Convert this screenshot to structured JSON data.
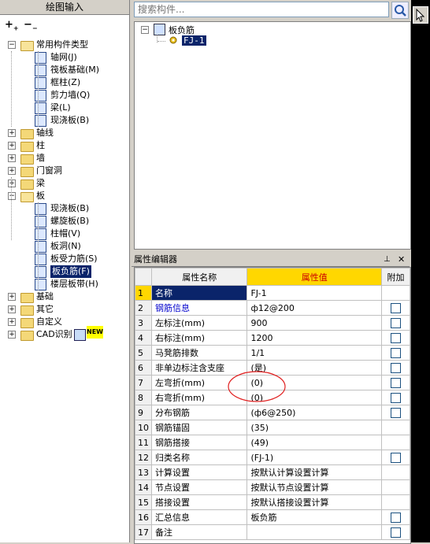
{
  "left_panel": {
    "title": "绘图输入",
    "tree": [
      {
        "label": "常用构件类型",
        "type": "folder",
        "level": 0,
        "expanded": true
      },
      {
        "label": "轴网(J)",
        "type": "item",
        "level": 1,
        "icon": "axis-grid-icon"
      },
      {
        "label": "筏板基础(M)",
        "type": "item",
        "level": 1,
        "icon": "raft-foundation-icon"
      },
      {
        "label": "框柱(Z)",
        "type": "item",
        "level": 1,
        "icon": "column-icon"
      },
      {
        "label": "剪力墙(Q)",
        "type": "item",
        "level": 1,
        "icon": "shear-wall-icon"
      },
      {
        "label": "梁(L)",
        "type": "item",
        "level": 1,
        "icon": "beam-icon"
      },
      {
        "label": "现浇板(B)",
        "type": "item",
        "level": 1,
        "icon": "slab-icon"
      },
      {
        "label": "轴线",
        "type": "folder",
        "level": 0,
        "expanded": false
      },
      {
        "label": "柱",
        "type": "folder",
        "level": 0,
        "expanded": false
      },
      {
        "label": "墙",
        "type": "folder",
        "level": 0,
        "expanded": false
      },
      {
        "label": "门窗洞",
        "type": "folder",
        "level": 0,
        "expanded": false
      },
      {
        "label": "梁",
        "type": "folder",
        "level": 0,
        "expanded": false
      },
      {
        "label": "板",
        "type": "folder",
        "level": 0,
        "expanded": true
      },
      {
        "label": "现浇板(B)",
        "type": "item",
        "level": 1,
        "icon": "slab-icon"
      },
      {
        "label": "螺旋板(B)",
        "type": "item",
        "level": 1,
        "icon": "spiral-slab-icon"
      },
      {
        "label": "柱帽(V)",
        "type": "item",
        "level": 1,
        "icon": "column-cap-icon"
      },
      {
        "label": "板洞(N)",
        "type": "item",
        "level": 1,
        "icon": "slab-hole-icon"
      },
      {
        "label": "板受力筋(S)",
        "type": "item",
        "level": 1,
        "icon": "slab-rebar-icon"
      },
      {
        "label": "板负筋(F)",
        "type": "item",
        "level": 1,
        "icon": "negative-rebar-icon",
        "selected": true
      },
      {
        "label": "楼层板带(H)",
        "type": "item",
        "level": 1,
        "icon": "floor-strip-icon"
      },
      {
        "label": "基础",
        "type": "folder",
        "level": 0,
        "expanded": false
      },
      {
        "label": "其它",
        "type": "folder",
        "level": 0,
        "expanded": false
      },
      {
        "label": "自定义",
        "type": "folder",
        "level": 0,
        "expanded": false
      },
      {
        "label": "CAD识别",
        "type": "folder",
        "level": 0,
        "expanded": false,
        "badge": "NEW"
      }
    ]
  },
  "search": {
    "placeholder": "搜索构件..."
  },
  "component_tree": {
    "root_label": "板负筋",
    "child_label": "FJ-1"
  },
  "property_editor": {
    "title": "属性编辑器",
    "headers": {
      "num": "",
      "name": "属性名称",
      "value": "属性值",
      "extra": "附加"
    },
    "rows": [
      {
        "num": "1",
        "name": "名称",
        "value": "FJ-1",
        "checkbox": false,
        "name_color": "#0000cc",
        "selected": true
      },
      {
        "num": "2",
        "name": "钢筋信息",
        "value": "ф12@200",
        "checkbox": true,
        "name_color": "#0000cc"
      },
      {
        "num": "3",
        "name": "左标注(mm)",
        "value": "900",
        "checkbox": true
      },
      {
        "num": "4",
        "name": "右标注(mm)",
        "value": "1200",
        "checkbox": true
      },
      {
        "num": "5",
        "name": "马凳筋排数",
        "value": "1/1",
        "checkbox": true
      },
      {
        "num": "6",
        "name": "非单边标注含支座",
        "value": "(是)",
        "checkbox": true
      },
      {
        "num": "7",
        "name": "左弯折(mm)",
        "value": "(0)",
        "checkbox": true
      },
      {
        "num": "8",
        "name": "右弯折(mm)",
        "value": "(0)",
        "checkbox": true
      },
      {
        "num": "9",
        "name": "分布钢筋",
        "value": "(ф6@250)",
        "checkbox": true
      },
      {
        "num": "10",
        "name": "钢筋锚固",
        "value": "(35)",
        "checkbox": false
      },
      {
        "num": "11",
        "name": "钢筋搭接",
        "value": "(49)",
        "checkbox": false
      },
      {
        "num": "12",
        "name": "归类名称",
        "value": "(FJ-1)",
        "checkbox": true
      },
      {
        "num": "13",
        "name": "计算设置",
        "value": "按默认计算设置计算",
        "checkbox": false
      },
      {
        "num": "14",
        "name": "节点设置",
        "value": "按默认节点设置计算",
        "checkbox": false
      },
      {
        "num": "15",
        "name": "搭接设置",
        "value": "按默认搭接设置计算",
        "checkbox": false
      },
      {
        "num": "16",
        "name": "汇总信息",
        "value": "板负筋",
        "checkbox": true
      },
      {
        "num": "17",
        "name": "备注",
        "value": "",
        "checkbox": true
      }
    ]
  },
  "colors": {
    "selection": "#0a246a",
    "header_value": "#ffd700",
    "link_blue": "#0000cc",
    "annotation_circle": "#e02020"
  }
}
